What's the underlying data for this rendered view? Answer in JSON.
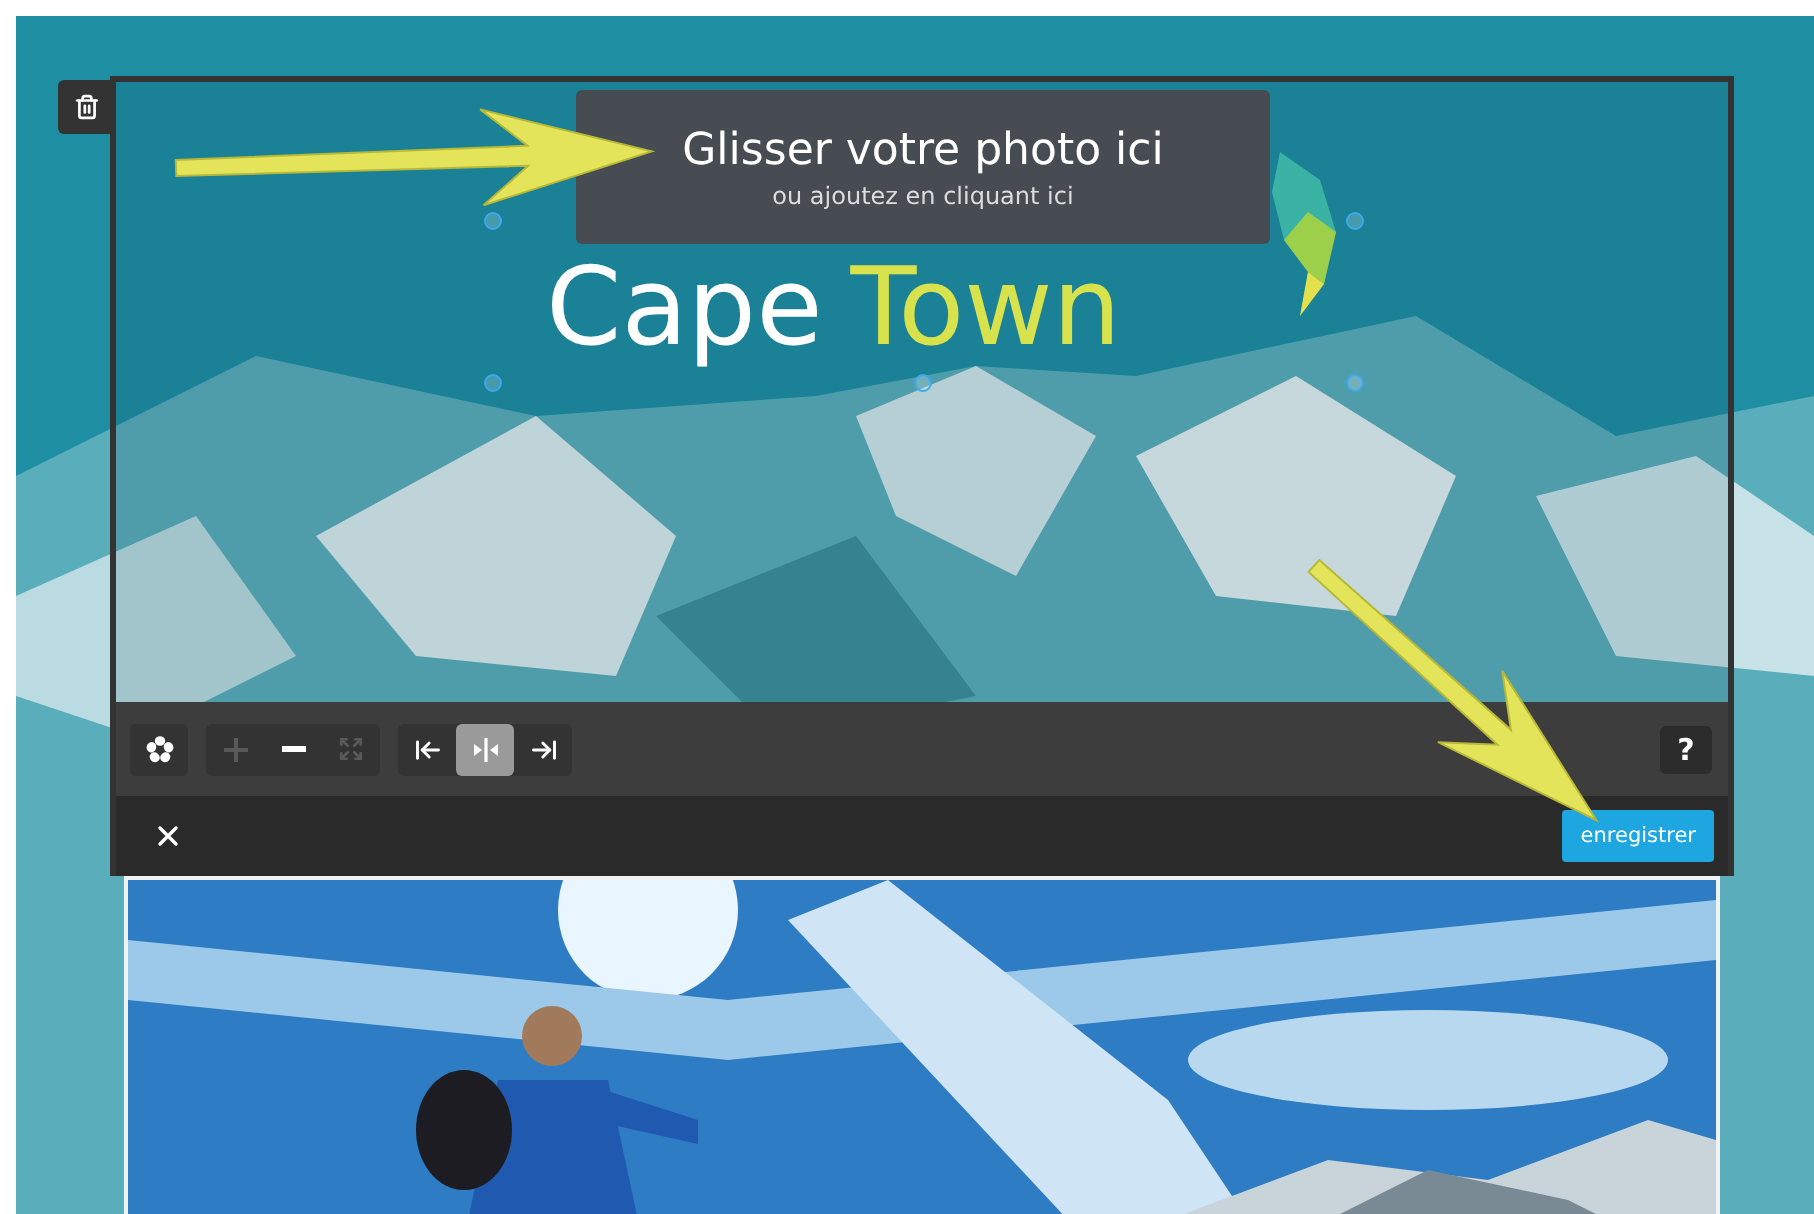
{
  "tooltip": {
    "title": "Glisser votre photo ici",
    "subtitle": "ou ajoutez en cliquant ici"
  },
  "logo": {
    "words": [
      {
        "text": "Cape",
        "color": "#ffffff"
      },
      {
        "text": "Town",
        "color": "#d8e24c"
      }
    ]
  },
  "toolbar": {
    "groups": [
      {
        "items": [
          {
            "kind": "rotate",
            "disabled": false
          }
        ]
      },
      {
        "items": [
          {
            "kind": "zoom-in",
            "disabled": true
          },
          {
            "kind": "zoom-out",
            "disabled": false
          },
          {
            "kind": "fit",
            "disabled": true
          }
        ]
      },
      {
        "items": [
          {
            "kind": "align-left",
            "selected": false
          },
          {
            "kind": "align-center",
            "selected": true
          },
          {
            "kind": "align-right",
            "selected": false
          }
        ]
      }
    ],
    "help": "?"
  },
  "footer": {
    "save": "enregistrer"
  }
}
